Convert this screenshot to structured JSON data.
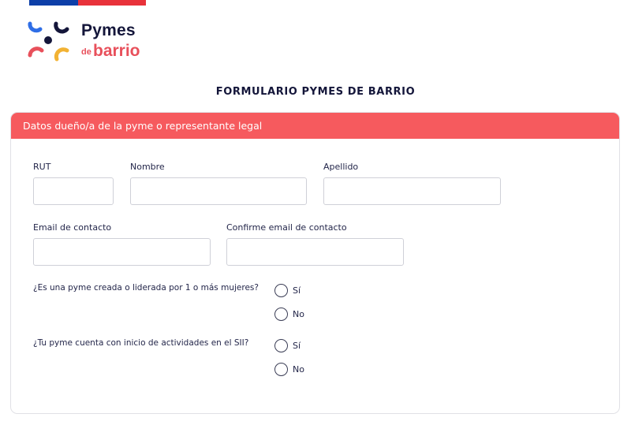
{
  "header": {
    "brand_name_top": "Pymes",
    "brand_name_small": "de",
    "brand_name_bottom": "barrio"
  },
  "form": {
    "title": "FORMULARIO PYMES DE BARRIO",
    "section_title": "Datos dueño/a de la pyme o representante legal",
    "fields": {
      "rut_label": "RUT",
      "rut_value": "",
      "nombre_label": "Nombre",
      "nombre_value": "",
      "apellido_label": "Apellido",
      "apellido_value": "",
      "email_label": "Email de contacto",
      "email_value": "",
      "confirm_email_label": "Confirme email de contacto",
      "confirm_email_value": ""
    },
    "questions": [
      {
        "text": "¿Es una pyme creada o liderada por 1 o más mujeres?",
        "options": [
          "Sí",
          "No"
        ],
        "selected": null
      },
      {
        "text": "¿Tu pyme cuenta con inicio de actividades en el SII?",
        "options": [
          "Sí",
          "No"
        ],
        "selected": null
      }
    ]
  },
  "colors": {
    "flag_blue": "#0d3fa8",
    "flag_red": "#e8323a",
    "section_header": "#f65a5e",
    "brand_navy": "#14163a",
    "brand_coral": "#e8505b"
  }
}
